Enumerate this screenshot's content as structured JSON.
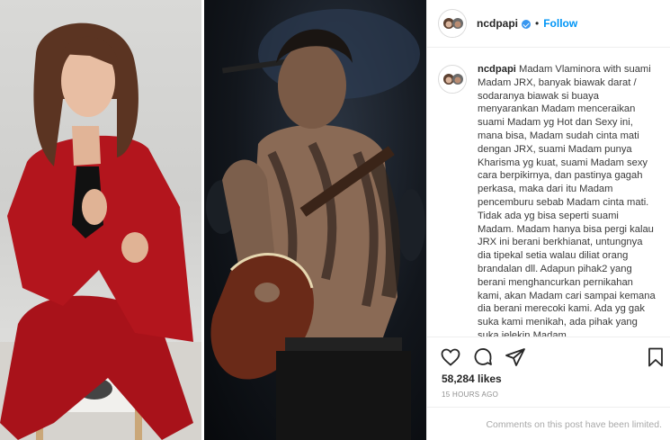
{
  "post": {
    "username": "ncdpapi",
    "dot": "•",
    "follow_label": "Follow",
    "caption_username": "ncdpapi",
    "caption_text": "Madam Vlaminora with suami Madam JRX, banyak biawak darat / sodaranya biawak si buaya menyarankan Madam menceraikan suami Madam yg Hot dan Sexy ini, mana bisa, Madam sudah cinta mati dengan JRX, suami Madam punya Kharisma yg kuat, suami Madam sexy cara berpikirnya, dan pastinya gagah perkasa, maka dari itu Madam pencemburu sebab Madam cinta mati. Tidak ada yg bisa seperti suami Madam. Madam hanya bisa pergi kalau JRX ini berani berkhianat, untungnya dia tipekal setia walau diliat orang brandalan dll. Adapun pihak2 yang berani menghancurkan pernikahan kami, akan Madam cari sampai kemana dia berani merecoki kami. Ada yg gak suka kami menikah, ada pihak yang suka jelekin Madam",
    "likes": "58,284 likes",
    "time": "15 HOURS AGO",
    "comments_limited": "Comments on this post have been limited."
  },
  "icons": {
    "like": "heart-icon",
    "comment": "comment-icon",
    "share": "share-icon",
    "save": "bookmark-icon"
  },
  "colors": {
    "accent": "#0095f6",
    "verified": "#3897f0",
    "suit_red": "#b3151d"
  }
}
